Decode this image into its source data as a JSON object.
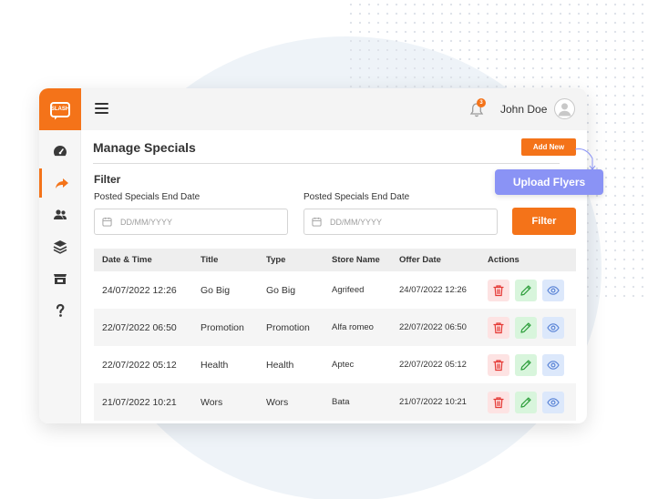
{
  "app": {
    "logo_text": "SLASH"
  },
  "header": {
    "notification_count": "3",
    "user_name": "John Doe"
  },
  "sidebar": {
    "items": [
      {
        "name": "dashboard",
        "icon": "speedometer-icon",
        "active": false
      },
      {
        "name": "share",
        "icon": "share-arrow-icon",
        "active": true
      },
      {
        "name": "users",
        "icon": "users-icon",
        "active": false
      },
      {
        "name": "layers",
        "icon": "layers-icon",
        "active": false
      },
      {
        "name": "store",
        "icon": "store-icon",
        "active": false
      },
      {
        "name": "help",
        "icon": "question-icon",
        "active": false
      }
    ]
  },
  "main": {
    "title": "Manage Specials",
    "add_new_label": "Add New",
    "upload_flyers_label": "Upload Flyers",
    "filter": {
      "title": "Filter",
      "field1_label": "Posted Specials End Date",
      "field1_placeholder": "DD/MM/YYYY",
      "field2_label": "Posted Specials End Date",
      "field2_placeholder": "DD/MM/YYYY",
      "button_label": "Filter"
    },
    "table": {
      "columns": [
        "Date & Time",
        "Title",
        "Type",
        "Store Name",
        "Offer Date",
        "Actions"
      ],
      "rows": [
        {
          "datetime": "24/07/2022 12:26",
          "title": "Go Big",
          "type": "Go Big",
          "store": "Agrifeed",
          "offer_date": "24/07/2022 12:26"
        },
        {
          "datetime": "22/07/2022 06:50",
          "title": "Promotion",
          "type": "Promotion",
          "store": "Alfa romeo",
          "offer_date": "22/07/2022 06:50"
        },
        {
          "datetime": "22/07/2022 05:12",
          "title": "Health",
          "type": "Health",
          "store": "Aptec",
          "offer_date": "22/07/2022 05:12"
        },
        {
          "datetime": "21/07/2022 10:21",
          "title": "Wors",
          "type": "Wors",
          "store": "Bata",
          "offer_date": "21/07/2022 10:21"
        }
      ]
    }
  },
  "colors": {
    "accent": "#f47319",
    "upload": "#8a93f5",
    "delete": "#e53935",
    "edit": "#2e9e3c",
    "view": "#5a84d6"
  }
}
